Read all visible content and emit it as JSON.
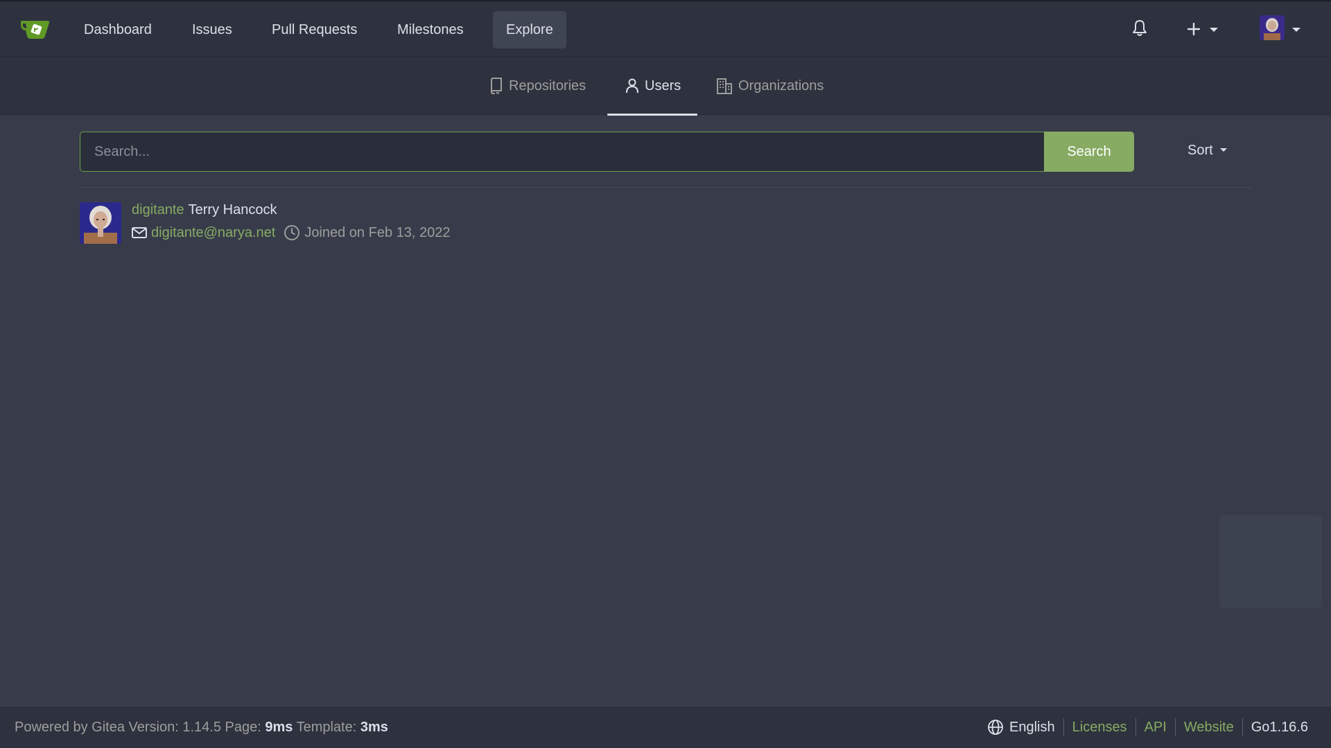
{
  "navbar": {
    "items": [
      {
        "label": "Dashboard"
      },
      {
        "label": "Issues"
      },
      {
        "label": "Pull Requests"
      },
      {
        "label": "Milestones"
      },
      {
        "label": "Explore"
      }
    ],
    "icons": [
      "bell-icon",
      "plus-icon",
      "avatar"
    ]
  },
  "subnav": {
    "tabs": [
      {
        "label": "Repositories",
        "icon": "repo-icon"
      },
      {
        "label": "Users",
        "icon": "person-icon"
      },
      {
        "label": "Organizations",
        "icon": "organization-icon"
      }
    ]
  },
  "search": {
    "placeholder": "Search...",
    "value": "",
    "button_label": "Search",
    "sort_label": "Sort"
  },
  "users": [
    {
      "username": "digitante",
      "full_name": "Terry Hancock",
      "email": "digitante@narya.net",
      "joined": "Joined on Feb 13, 2022"
    }
  ],
  "footer": {
    "powered": "Powered by Gitea Version: 1.14.5 Page: ",
    "page_time": "9ms",
    "template_label": " Template: ",
    "template_time": "3ms",
    "language": "English",
    "links": {
      "licenses": "Licenses",
      "api": "API",
      "website": "Website"
    },
    "go_version": "Go1.16.6"
  },
  "colors": {
    "background": "#383c4a",
    "navbar": "#2e323e",
    "accent": "#87ab63",
    "text": "#dbe0ea",
    "muted": "#9e9e9e"
  }
}
